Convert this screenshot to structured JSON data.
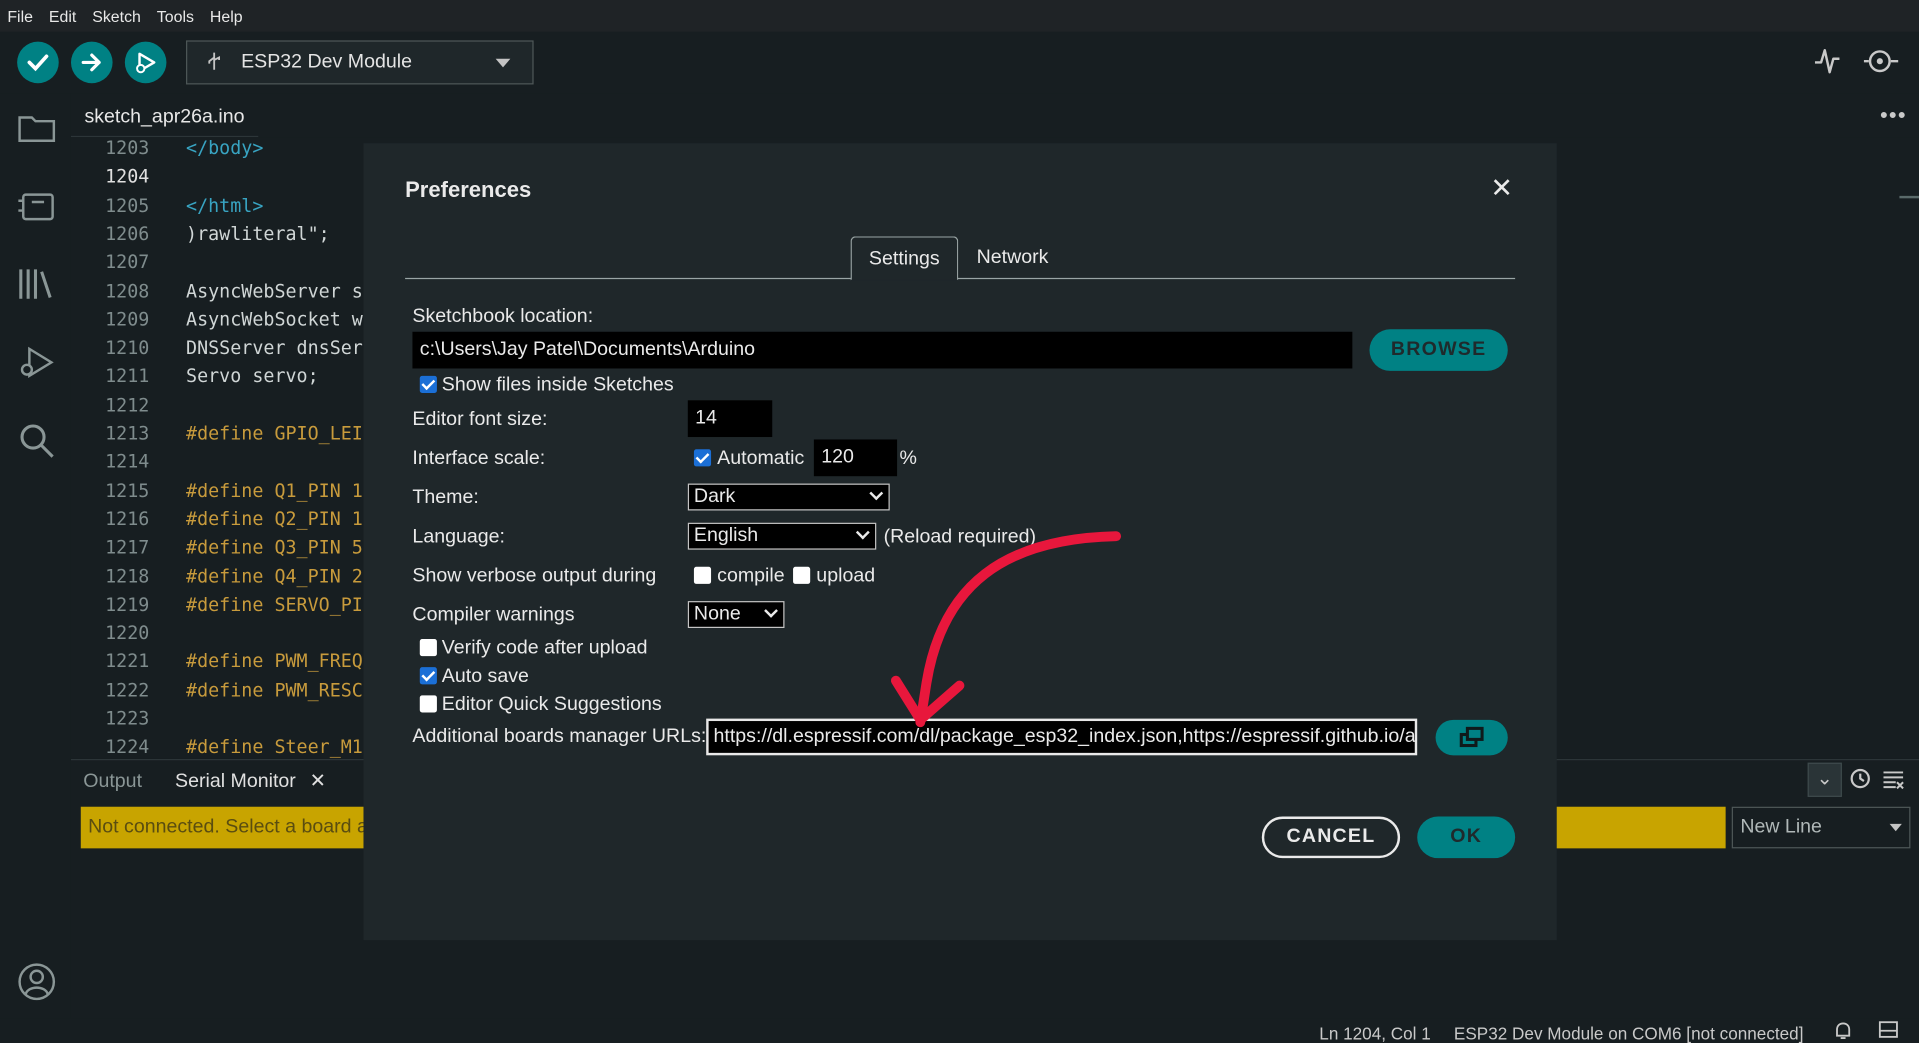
{
  "menu": [
    "File",
    "Edit",
    "Sketch",
    "Tools",
    "Help"
  ],
  "toolbar": {
    "board": "ESP32 Dev Module"
  },
  "editor": {
    "file_tab": "sketch_apr26a.ino",
    "lines": [
      {
        "n": "1203",
        "code": "</body>",
        "style": "tag"
      },
      {
        "n": "1204",
        "code": "",
        "style": "plain"
      },
      {
        "n": "1205",
        "code": "</html>",
        "style": "tag"
      },
      {
        "n": "1206",
        "code": ")rawliteral\";",
        "style": "plain"
      },
      {
        "n": "1207",
        "code": "",
        "style": "plain"
      },
      {
        "n": "1208",
        "code": "AsyncWebServer s",
        "style": "plain"
      },
      {
        "n": "1209",
        "code": "AsyncWebSocket w",
        "style": "plain"
      },
      {
        "n": "1210",
        "code": "DNSServer dnsSer",
        "style": "plain"
      },
      {
        "n": "1211",
        "code": "Servo servo;",
        "style": "plain"
      },
      {
        "n": "1212",
        "code": "",
        "style": "plain"
      },
      {
        "n": "1213",
        "code": "#define GPIO_LEI",
        "style": "kw"
      },
      {
        "n": "1214",
        "code": "",
        "style": "plain"
      },
      {
        "n": "1215",
        "code": "#define Q1_PIN 1",
        "style": "kw"
      },
      {
        "n": "1216",
        "code": "#define Q2_PIN 1",
        "style": "kw"
      },
      {
        "n": "1217",
        "code": "#define Q3_PIN 5",
        "style": "kw"
      },
      {
        "n": "1218",
        "code": "#define Q4_PIN 2",
        "style": "kw"
      },
      {
        "n": "1219",
        "code": "#define SERVO_PI",
        "style": "kw"
      },
      {
        "n": "1220",
        "code": "",
        "style": "plain"
      },
      {
        "n": "1221",
        "code": "#define PWM_FREQ",
        "style": "kw"
      },
      {
        "n": "1222",
        "code": "#define PWM_RESC",
        "style": "kw"
      },
      {
        "n": "1223",
        "code": "",
        "style": "plain"
      },
      {
        "n": "1224",
        "code": "#define Steer_M1",
        "style": "kw"
      }
    ],
    "active_line": "1204"
  },
  "panel": {
    "tab_output": "Output",
    "tab_serial": "Serial Monitor",
    "status_message": "Not connected. Select a board a",
    "line_ending": "New Line"
  },
  "statusbar": {
    "position": "Ln 1204, Col 1",
    "board": "ESP32 Dev Module on COM6 [not connected]"
  },
  "preferences": {
    "title": "Preferences",
    "tab_settings": "Settings",
    "tab_network": "Network",
    "sketchbook_label": "Sketchbook location:",
    "sketchbook_path": "c:\\Users\\Jay Patel\\Documents\\Arduino",
    "browse": "BROWSE",
    "show_files_label": "Show files inside Sketches",
    "show_files_checked": true,
    "font_size_label": "Editor font size:",
    "font_size": "14",
    "scale_label": "Interface scale:",
    "scale_auto_label": "Automatic",
    "scale_auto_checked": true,
    "scale_value": "120",
    "scale_unit": "%",
    "theme_label": "Theme:",
    "theme": "Dark",
    "language_label": "Language:",
    "language": "English",
    "reload_note": "(Reload required)",
    "verbose_label": "Show verbose output during",
    "compile_label": "compile",
    "compile_checked": false,
    "upload_label": "upload",
    "upload_checked": false,
    "warnings_label": "Compiler warnings",
    "warnings": "None",
    "verify_label": "Verify code after upload",
    "verify_checked": false,
    "autosave_label": "Auto save",
    "autosave_checked": true,
    "quick_label": "Editor Quick Suggestions",
    "quick_checked": false,
    "urls_label": "Additional boards manager URLs:",
    "urls_value": "https://dl.espressif.com/dl/package_esp32_index.json,https://espressif.github.io/ar",
    "cancel": "CANCEL",
    "ok": "OK"
  },
  "colors": {
    "accent": "#008184",
    "annotation": "#e8173c",
    "warning_bar": "#c8a400"
  }
}
